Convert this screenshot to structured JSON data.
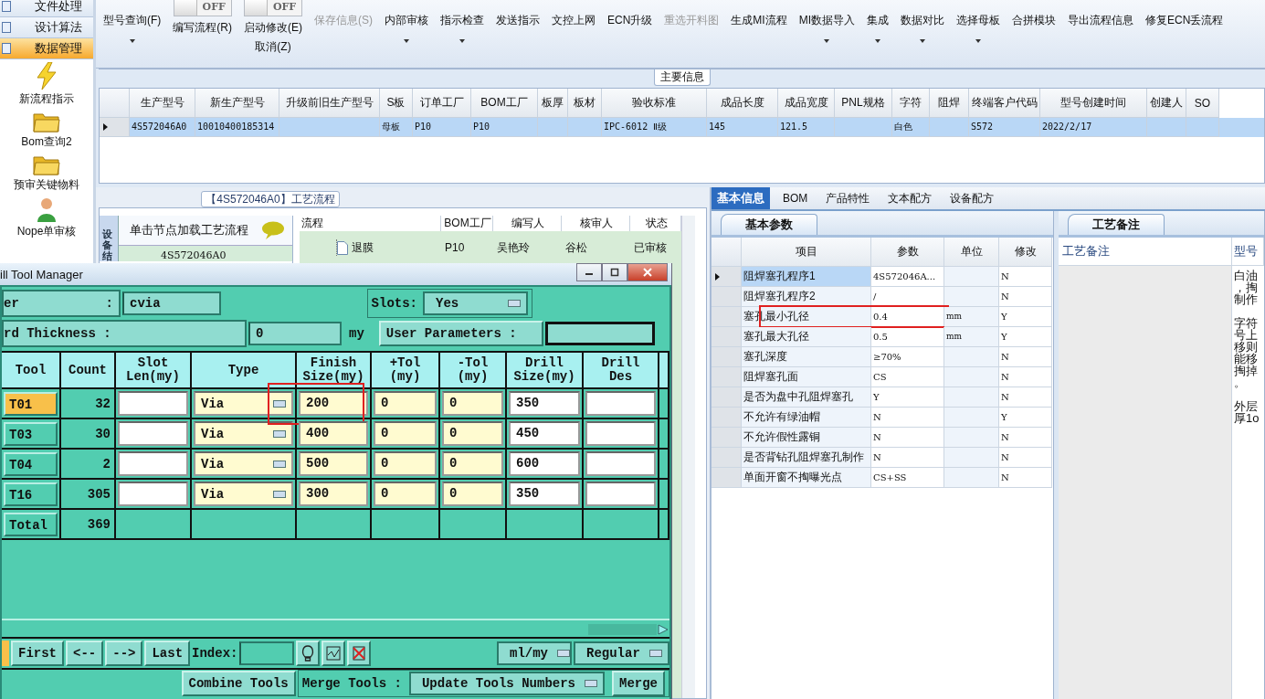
{
  "sidebar": {
    "items": [
      {
        "label": "文件处理",
        "selected": false
      },
      {
        "label": "设计算法",
        "selected": false
      },
      {
        "label": "数据管理",
        "selected": true
      }
    ],
    "shortcuts": [
      {
        "label": "新流程指示",
        "kind": "bolt"
      },
      {
        "label": "Bom查询2",
        "kind": "folder"
      },
      {
        "label": "预审关键物料",
        "kind": "folder"
      },
      {
        "label": "Nope单审核",
        "kind": "person"
      }
    ]
  },
  "toolbar": [
    {
      "label": "型号查询(F)",
      "dropdown": true,
      "disabled": false
    },
    {
      "label": "编写流程(R)",
      "toggle": "OFF",
      "dropdown": false,
      "disabled": false
    },
    {
      "label": "启动修改(E)",
      "sublabel": "取消(Z)",
      "toggle": "OFF",
      "dropdown": false,
      "disabled": false
    },
    {
      "label": "保存信息(S)",
      "dropdown": false,
      "disabled": true
    },
    {
      "label": "内部审核",
      "dropdown": true,
      "disabled": false
    },
    {
      "label": "指示检查",
      "dropdown": true,
      "disabled": false
    },
    {
      "label": "发送指示",
      "dropdown": false,
      "disabled": false
    },
    {
      "label": "文控上网",
      "dropdown": false,
      "disabled": false
    },
    {
      "label": "ECN升级",
      "dropdown": false,
      "disabled": false
    },
    {
      "label": "重选开料图",
      "dropdown": false,
      "disabled": true
    },
    {
      "label": "生成MI流程",
      "dropdown": false,
      "disabled": false
    },
    {
      "label": "MI数据导入",
      "dropdown": true,
      "disabled": false
    },
    {
      "label": "集成",
      "dropdown": true,
      "disabled": false
    },
    {
      "label": "数据对比",
      "dropdown": true,
      "disabled": false
    },
    {
      "label": "选择母板",
      "dropdown": true,
      "disabled": false
    },
    {
      "label": "合拼模块",
      "dropdown": false,
      "disabled": false
    },
    {
      "label": "导出流程信息",
      "dropdown": false,
      "disabled": false
    },
    {
      "label": "修复ECN丢流程",
      "dropdown": false,
      "disabled": false
    }
  ],
  "main_info": {
    "title": "主要信息",
    "columns": [
      "生产型号",
      "新生产型号",
      "升级前旧生产型号",
      "S板",
      "订单工厂",
      "BOM工厂",
      "板厚",
      "板材",
      "验收标准",
      "成品长度",
      "成品宽度",
      "PNL规格",
      "字符",
      "阻焊",
      "终端客户代码",
      "型号创建时间",
      "创建人",
      "SO"
    ],
    "rows": [
      {
        "selected": true,
        "cells": [
          "4S572046A0",
          "10010400185314",
          "",
          "母板",
          "P10",
          "P10",
          "",
          "",
          "IPC-6012 Ⅱ级",
          "145",
          "121.5",
          "",
          "白色",
          "",
          "S572",
          "2022/2/17",
          "",
          ""
        ]
      }
    ]
  },
  "process_panel": {
    "title": "【4S572046A0】工艺流程",
    "side_tab": "设备结",
    "tree_hint": "单击节点加载工艺流程",
    "tree_items": [
      "4S572046A0"
    ],
    "columns": [
      "流程",
      "BOM工厂",
      "编写人",
      "核审人",
      "状态"
    ],
    "rows": [
      {
        "cells": [
          "退膜",
          "P10",
          "吴艳玲",
          "谷松",
          "已审核"
        ]
      }
    ]
  },
  "info_panel": {
    "tabs": [
      {
        "label": "基本信息",
        "selected": true
      },
      {
        "label": "BOM",
        "selected": false
      },
      {
        "label": "产品特性",
        "selected": false
      },
      {
        "label": "文本配方",
        "selected": false
      },
      {
        "label": "设备配方",
        "selected": false
      }
    ],
    "params_tab": "基本参数",
    "columns": [
      "项目",
      "参数",
      "单位",
      "修改"
    ],
    "rows": [
      {
        "cells": [
          "阻焊塞孔程序1",
          "4S572046A...",
          "",
          "N"
        ],
        "selected": true,
        "highlighted": false
      },
      {
        "cells": [
          "阻焊塞孔程序2",
          "/",
          "",
          "N"
        ],
        "selected": false,
        "highlighted": false
      },
      {
        "cells": [
          "塞孔最小孔径",
          "0.4",
          "mm",
          "Y"
        ],
        "selected": false,
        "highlighted": true
      },
      {
        "cells": [
          "塞孔最大孔径",
          "0.5",
          "mm",
          "Y"
        ],
        "selected": false,
        "highlighted": false
      },
      {
        "cells": [
          "塞孔深度",
          "≥70%",
          "",
          "N"
        ],
        "selected": false,
        "highlighted": false
      },
      {
        "cells": [
          "阻焊塞孔面",
          "CS",
          "",
          "N"
        ],
        "selected": false,
        "highlighted": false
      },
      {
        "cells": [
          "是否为盘中孔阻焊塞孔",
          "Y",
          "",
          "N"
        ],
        "selected": false,
        "highlighted": false
      },
      {
        "cells": [
          "不允许有绿油帽",
          "N",
          "",
          "Y"
        ],
        "selected": false,
        "highlighted": false
      },
      {
        "cells": [
          "不允许假性露铜",
          "N",
          "",
          "N"
        ],
        "selected": false,
        "highlighted": false
      },
      {
        "cells": [
          "是否背钻孔阻焊塞孔制作",
          "N",
          "",
          "N"
        ],
        "selected": false,
        "highlighted": false
      },
      {
        "cells": [
          "单面开窗不掏曝光点",
          "CS+SS",
          "",
          "N"
        ],
        "selected": false,
        "highlighted": false
      }
    ],
    "remarks_tab": "工艺备注",
    "remarks_columns": [
      "工艺备注",
      "型号"
    ],
    "remarks_blocks": [
      [
        "白油",
        "，掏",
        "制作"
      ],
      [
        "字符",
        "号上",
        "移则",
        "能移",
        "掏掉",
        "。"
      ],
      [
        "外层",
        "厚1o"
      ]
    ]
  },
  "drill_manager": {
    "title": "ill Tool Manager",
    "layer_label": "er",
    "layer_colon": ":",
    "layer_value": "cvia",
    "slots_label": "Slots:",
    "slots_value": "Yes",
    "thickness_label": "rd Thickness :",
    "thickness_value": "0",
    "thickness_unit": "my",
    "user_params": "User Parameters :",
    "columns": [
      "Tool",
      "Count",
      "Slot\nLen(my)",
      "Type",
      "Finish\nSize(my)",
      "+Tol\n(my)",
      "-Tol\n(my)",
      "Drill\nSize(my)",
      "Drill\nDes"
    ],
    "tools": [
      {
        "tool": "T01",
        "count": "32",
        "type": "Via",
        "finish": "200",
        "plus_tol": "0",
        "minus_tol": "0",
        "drill_size": "350",
        "selected": true,
        "highlighted": true
      },
      {
        "tool": "T03",
        "count": "30",
        "type": "Via",
        "finish": "400",
        "plus_tol": "0",
        "minus_tol": "0",
        "drill_size": "450",
        "selected": false,
        "highlighted": false
      },
      {
        "tool": "T04",
        "count": "2",
        "type": "Via",
        "finish": "500",
        "plus_tol": "0",
        "minus_tol": "0",
        "drill_size": "600",
        "selected": false,
        "highlighted": false
      },
      {
        "tool": "T16",
        "count": "305",
        "type": "Via",
        "finish": "300",
        "plus_tol": "0",
        "minus_tol": "0",
        "drill_size": "350",
        "selected": false,
        "highlighted": false
      }
    ],
    "total": {
      "label": "Total",
      "count": "369"
    },
    "nav": [
      "First",
      "<--",
      "-->",
      "Last"
    ],
    "index_label": "Index:",
    "units": "ml/my",
    "mode": "Regular",
    "combine": "Combine Tools",
    "merge_label": "Merge Tools :",
    "update": "Update Tools Numbers",
    "merge": "Merge"
  }
}
